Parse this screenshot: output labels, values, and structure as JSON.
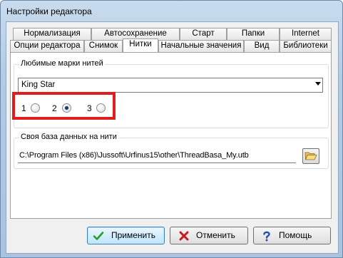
{
  "window": {
    "title": "Настройки редактора"
  },
  "tabs_row1": [
    {
      "label": "Нормализация"
    },
    {
      "label": "Автосохранение"
    },
    {
      "label": "Старт"
    },
    {
      "label": "Папки"
    },
    {
      "label": "Internet"
    }
  ],
  "tabs_row2": [
    {
      "label": "Опции редактора"
    },
    {
      "label": "Снимок"
    },
    {
      "label": "Нитки",
      "active": true
    },
    {
      "label": "Начальные значения"
    },
    {
      "label": "Вид"
    },
    {
      "label": "Библиотеки"
    }
  ],
  "favorites": {
    "group_label": "Любимые марки нитей",
    "selected_brand": "King Star",
    "radios": [
      {
        "label": "1",
        "checked": false
      },
      {
        "label": "2",
        "checked": true
      },
      {
        "label": "3",
        "checked": false
      }
    ]
  },
  "database": {
    "group_label": "Своя база данных на нити",
    "path": "C:\\Program Files (x86)\\Jussoft\\Urfinus15\\other\\ThreadBasa_My.utb",
    "browse_icon": "folder-open-icon"
  },
  "buttons": {
    "apply": "Применить",
    "cancel": "Отменить",
    "help": "Помощь"
  },
  "colors": {
    "highlight": "#e11c1c",
    "title_bar": "#b3cbe5"
  }
}
